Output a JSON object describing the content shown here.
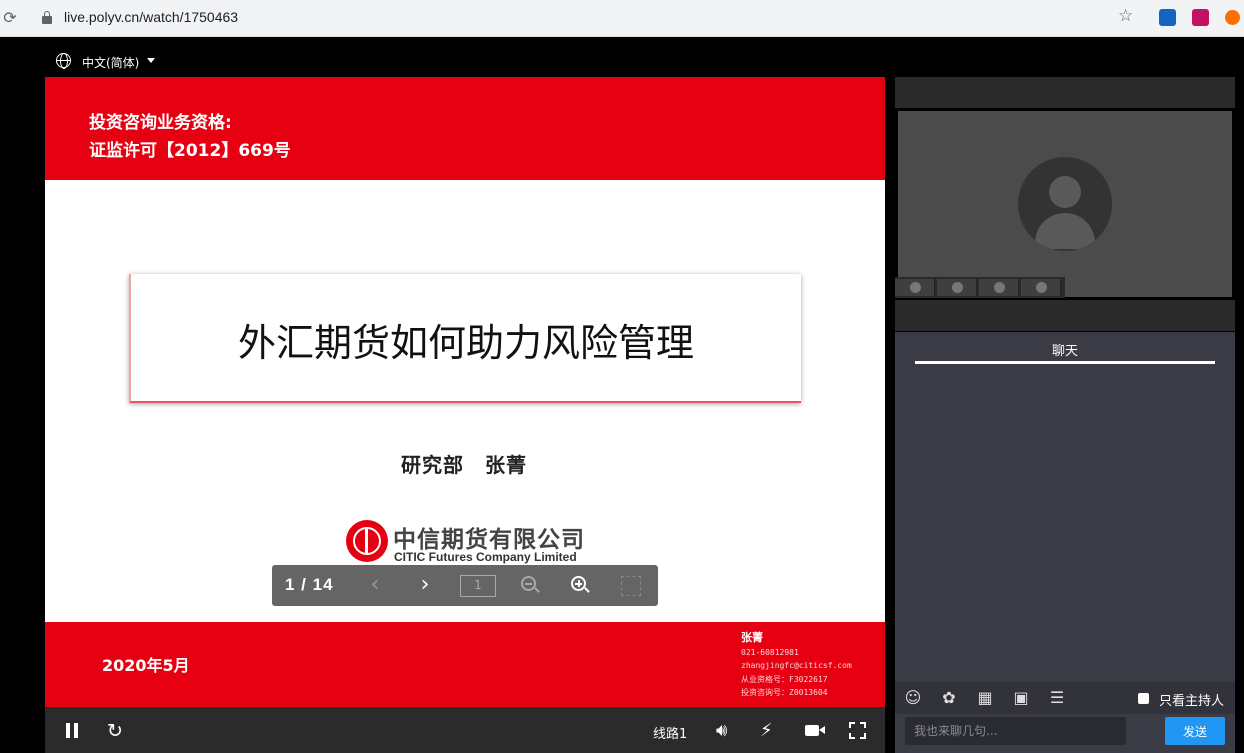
{
  "browser": {
    "url": "live.polyv.cn/watch/1750463"
  },
  "player": {
    "language_label": "中文(简体)"
  },
  "slide": {
    "qualification_line1": "投资咨询业务资格:",
    "qualification_line2": "证监许可【2012】669号",
    "title": "外汇期货如何助力风险管理",
    "presenter": "研究部　张菁",
    "company_cn": "中信期货有限公司",
    "company_en": "CITIC Futures Company Limited",
    "date": "2020年5月",
    "contact": {
      "name": "张菁",
      "phone": "021-60812981",
      "email": "zhangjingfc@citicsf.com",
      "license": "从业资格号：F3022617",
      "advisor_no": "投资咨询号：Z0013604"
    }
  },
  "page_control": {
    "counter": "1 / 14",
    "page_input_value": "1"
  },
  "controls": {
    "line_label": "线路1"
  },
  "chat": {
    "tab_label": "聊天",
    "host_only_label": "只看主持人",
    "input_placeholder": "我也来聊几句...",
    "send_label": "发送"
  },
  "colors": {
    "brand_red": "#e60012",
    "send_blue": "#2196f3",
    "chat_bg": "#3b3b45"
  }
}
